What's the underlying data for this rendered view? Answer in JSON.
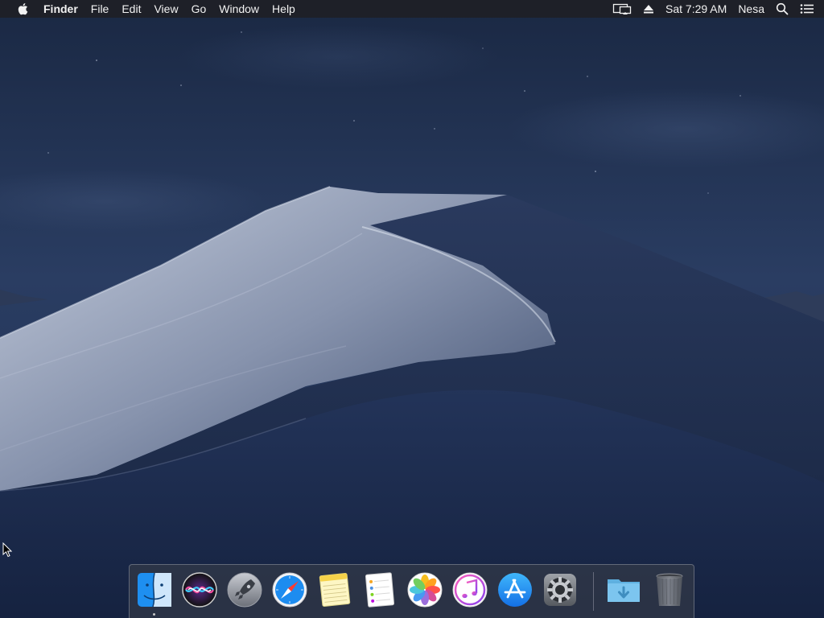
{
  "menubar": {
    "app_name": "Finder",
    "menus": [
      "File",
      "Edit",
      "View",
      "Go",
      "Window",
      "Help"
    ],
    "status": {
      "display_icon": "airplay-display-icon",
      "eject_icon": "eject-icon",
      "clock": "Sat 7:29 AM",
      "user": "Nesa",
      "spotlight_icon": "search-icon",
      "notification_icon": "notification-center-icon"
    }
  },
  "dock": {
    "apps": [
      {
        "icon": "finder-icon",
        "running": true
      },
      {
        "icon": "siri-icon",
        "running": false
      },
      {
        "icon": "launchpad-icon",
        "running": false
      },
      {
        "icon": "safari-icon",
        "running": false
      },
      {
        "icon": "notes-icon",
        "running": false
      },
      {
        "icon": "reminders-icon",
        "running": false
      },
      {
        "icon": "photos-icon",
        "running": false
      },
      {
        "icon": "itunes-icon",
        "running": false
      },
      {
        "icon": "app-store-icon",
        "running": false
      },
      {
        "icon": "system-preferences-icon",
        "running": false
      }
    ],
    "stacks": [
      {
        "icon": "downloads-folder-icon"
      },
      {
        "icon": "trash-icon"
      }
    ]
  },
  "colors": {
    "menubar_bg": "#1e2026",
    "menubar_text": "#f2f2f2",
    "sky_top": "#1b2a45",
    "dune_light": "#aab4c8",
    "dune_dark": "#1a2748"
  }
}
